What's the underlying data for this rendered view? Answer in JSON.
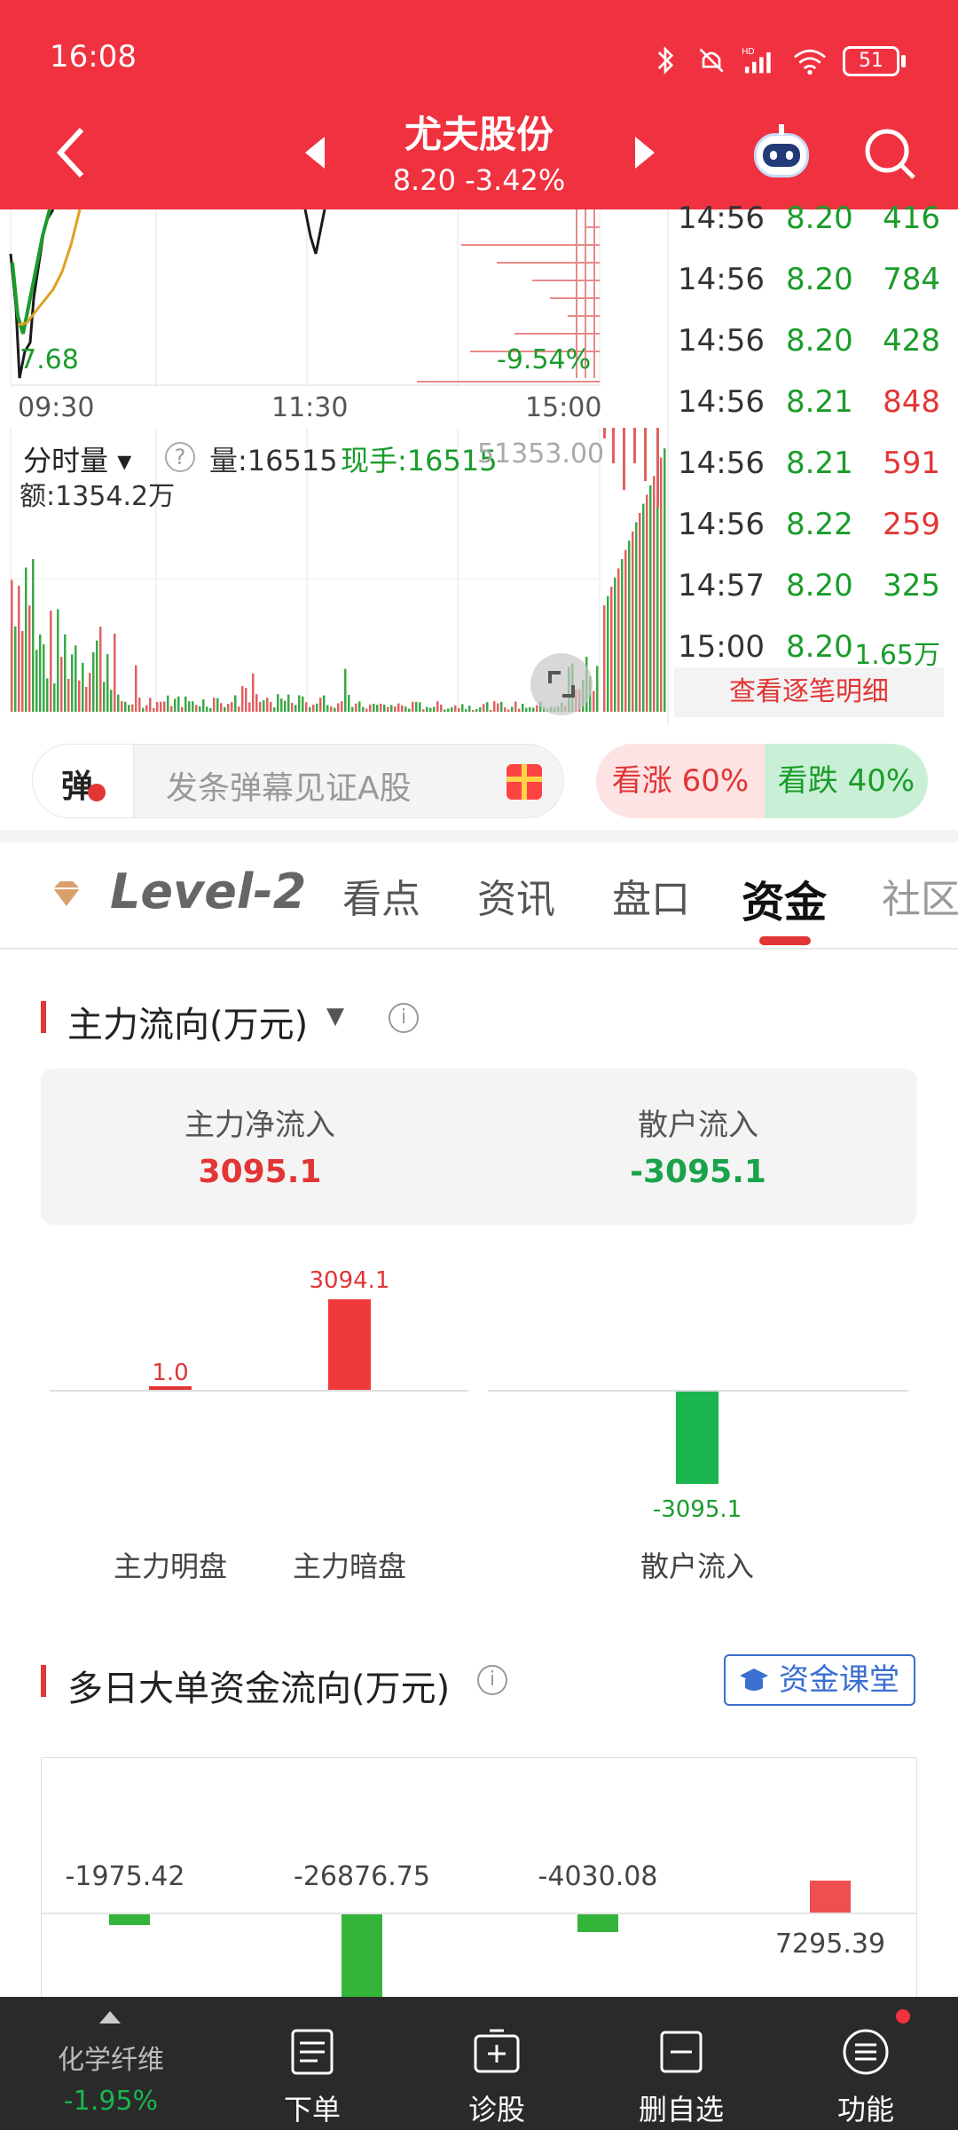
{
  "status": {
    "time": "16:08",
    "battery": "51"
  },
  "header": {
    "title": "尤夫股份",
    "price": "8.20",
    "change": "-3.42%"
  },
  "chart": {
    "price_label_low": "7.68",
    "pct_label": "-9.54%",
    "time_ticks": [
      "09:30",
      "11:30",
      "15:00"
    ],
    "vol_selector": "分时量",
    "vol_label": "量:16515",
    "hand_label": "现手:16515",
    "max_vol": "51353.00",
    "amount_label": "额:1354.2万"
  },
  "trades": [
    {
      "time": "14:56",
      "price": "8.20",
      "vol": "416",
      "dir": "green"
    },
    {
      "time": "14:56",
      "price": "8.20",
      "vol": "784",
      "dir": "green"
    },
    {
      "time": "14:56",
      "price": "8.20",
      "vol": "428",
      "dir": "green"
    },
    {
      "time": "14:56",
      "price": "8.21",
      "vol": "848",
      "dir": "red"
    },
    {
      "time": "14:56",
      "price": "8.21",
      "vol": "591",
      "dir": "red"
    },
    {
      "time": "14:56",
      "price": "8.22",
      "vol": "259",
      "dir": "red"
    },
    {
      "time": "14:57",
      "price": "8.20",
      "vol": "325",
      "dir": "green"
    },
    {
      "time": "15:00",
      "price": "8.20",
      "vol": "1.65万",
      "dir": "green"
    }
  ],
  "trade_detail_link": "查看逐笔明细",
  "danmu": {
    "badge": "弹",
    "placeholder": "发条弹幕见证A股",
    "up": "看涨 60%",
    "down": "看跌 40%"
  },
  "tabs": [
    "Level-2",
    "看点",
    "资讯",
    "盘口",
    "资金",
    "社区"
  ],
  "active_tab": "资金",
  "flow": {
    "title": "主力流向(万元)",
    "main_net_label": "主力净流入",
    "main_net_value": "3095.1",
    "retail_label": "散户流入",
    "retail_value": "-3095.1",
    "bars": [
      {
        "label": "主力明盘",
        "value": "1.0"
      },
      {
        "label": "主力暗盘",
        "value": "3094.1"
      },
      {
        "label": "散户流入",
        "value": "-3095.1"
      }
    ]
  },
  "multi": {
    "title": "多日大单资金流向(万元)",
    "class_button": "资金课堂",
    "values": [
      "-1975.42",
      "-26876.75",
      "-4030.08",
      "7295.39"
    ]
  },
  "bottom_nav": {
    "sector_name": "化学纤维",
    "sector_change": "-1.95%",
    "items": [
      "下单",
      "诊股",
      "删自选",
      "功能"
    ]
  },
  "colors": {
    "brand_red": "#f0313f",
    "up": "#e23535",
    "down": "#1a9c2a"
  }
}
